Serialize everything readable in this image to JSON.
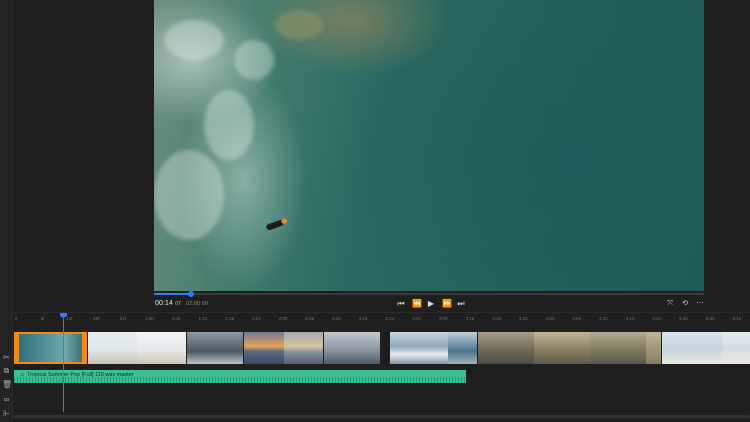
{
  "player": {
    "timecode_main": "00:14",
    "timecode_frames": "07",
    "timecode_total": "02:00 00",
    "scrub_progress": 0.067
  },
  "transport": {
    "icons": [
      "skip-back-icon",
      "step-back-icon",
      "play-icon",
      "step-forward-icon",
      "skip-forward-icon"
    ]
  },
  "view_controls": {
    "icons": [
      "fit-icon",
      "loop-icon",
      "more-icon"
    ]
  },
  "ruler": {
    "ticks": [
      "0",
      "6f",
      "12f",
      "18f",
      "24f",
      "1:00",
      "1:06",
      "1:12",
      "1:18",
      "1:24",
      "2:00",
      "2:06",
      "2:12",
      "2:18",
      "2:24",
      "3:00",
      "3:06",
      "3:12",
      "3:18",
      "3:24",
      "4:00",
      "4:06",
      "4:12",
      "4:18",
      "4:24",
      "5:00",
      "5:06",
      "5:12"
    ]
  },
  "audio": {
    "track_label": "Tropical Summer Pop [Full] 110 wav master",
    "color": "#3dbf95"
  },
  "colors": {
    "accent": "#2d7ff9",
    "selection": "#f08a1f"
  }
}
